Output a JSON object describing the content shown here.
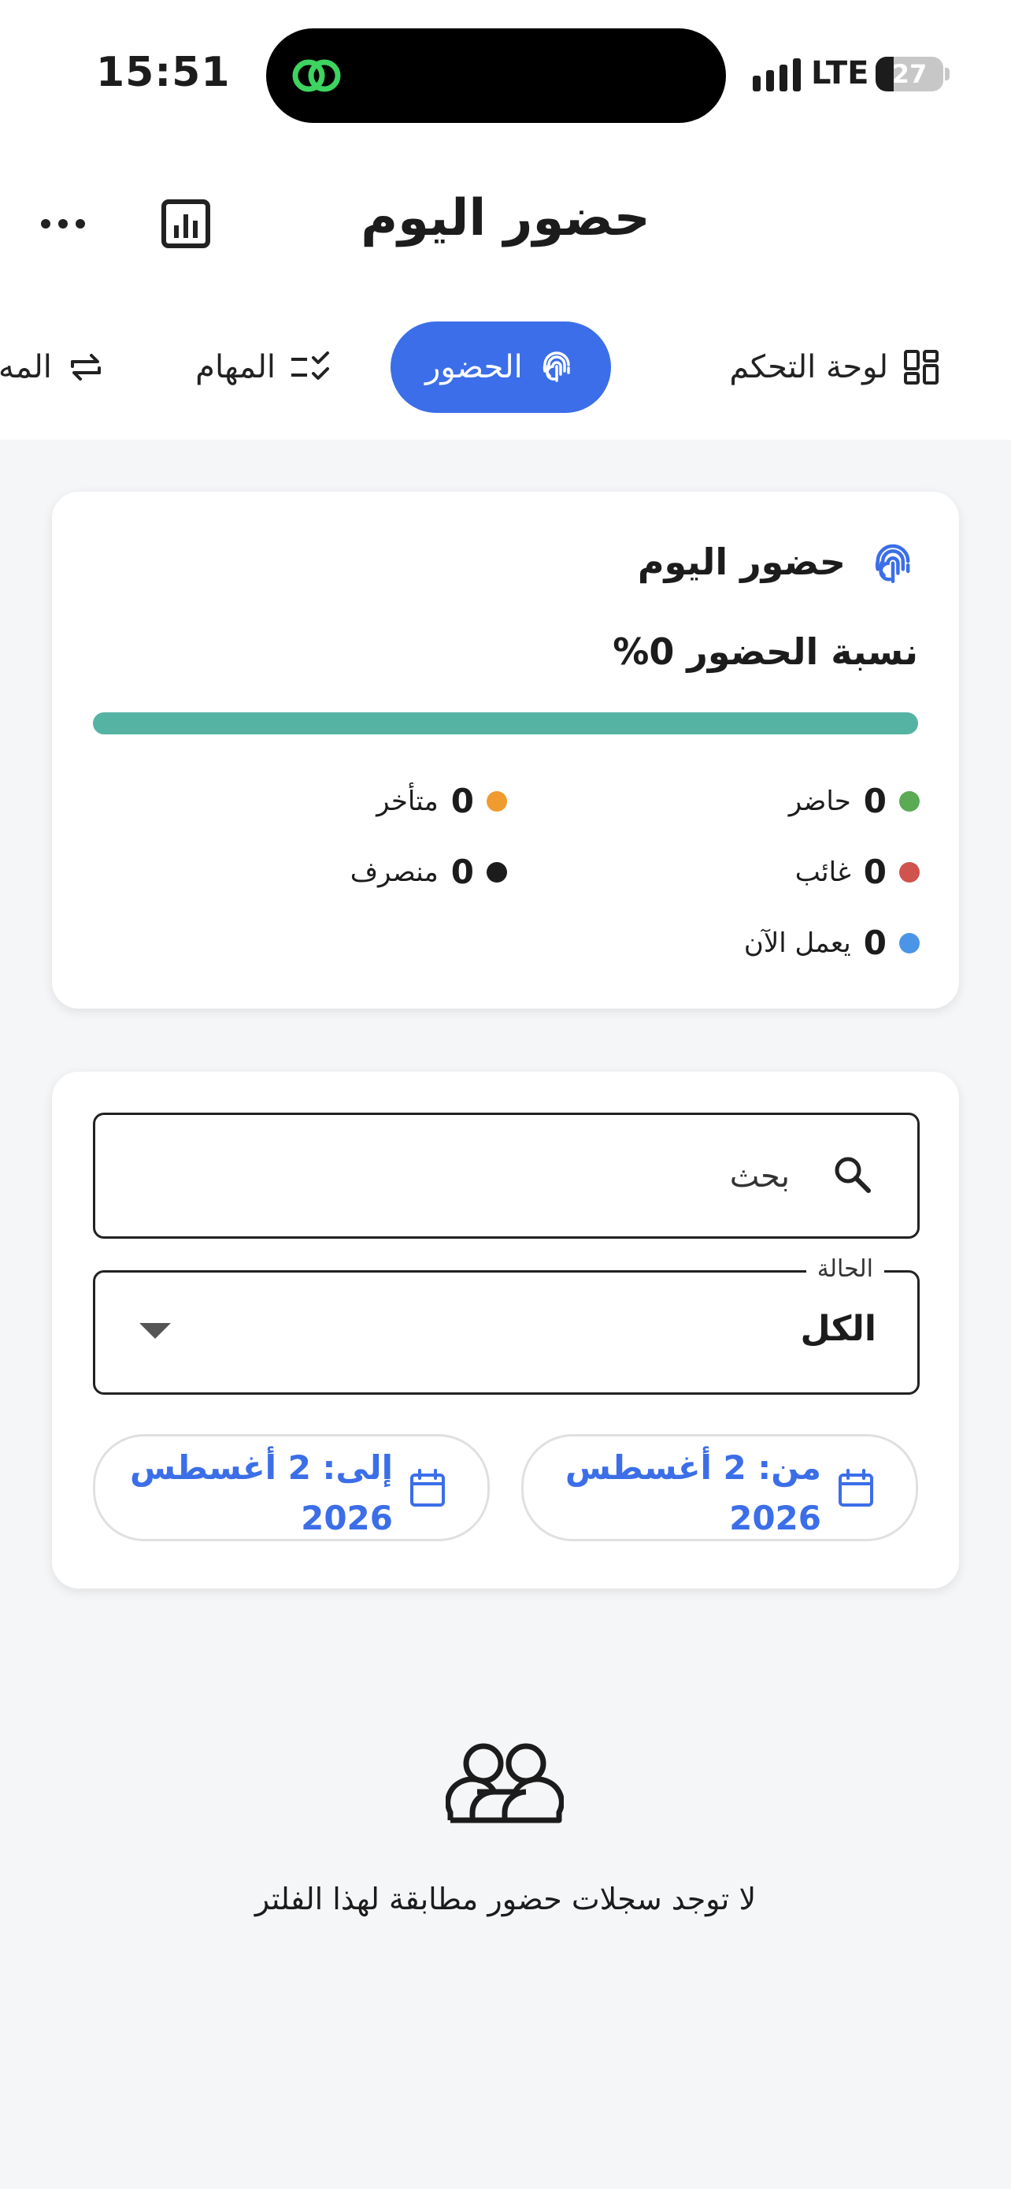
{
  "status_bar": {
    "time": "15:51",
    "network": "LTE",
    "battery": "27",
    "battery_level": 0.27
  },
  "app_bar": {
    "title": "حضور اليوم",
    "icons": [
      "more-horizontal-icon",
      "bar-chart-icon"
    ]
  },
  "tabs": [
    {
      "label": "لوحة التحكم",
      "icon": "dashboard-icon",
      "active": false
    },
    {
      "label": "الحضور",
      "icon": "fingerprint-icon",
      "active": true
    },
    {
      "label": "المهام",
      "icon": "checklist-icon",
      "active": false
    },
    {
      "label": "المه",
      "icon": "swap-icon",
      "active": false
    }
  ],
  "today_card": {
    "title": "حضور اليوم",
    "rate_text": "نسبة الحضور 0%",
    "rate_value": 0,
    "stats": [
      {
        "label": "حاضر",
        "value": "0",
        "color": "#5aab53"
      },
      {
        "label": "متأخر",
        "value": "0",
        "color": "#ef9b2f"
      },
      {
        "label": "غائب",
        "value": "0",
        "color": "#d0534e"
      },
      {
        "label": "منصرف",
        "value": "0",
        "color": "#1c1c1c"
      },
      {
        "label": "يعمل الآن",
        "value": "0",
        "color": "#4a95e8"
      }
    ]
  },
  "filters": {
    "search_placeholder": "بحث",
    "status_label": "الحالة",
    "status_value": "الكل",
    "from_date": "من: 2 أغسطس 2026",
    "to_date": "إلى: 2 أغسطس 2026"
  },
  "empty_state": {
    "icon": "people-icon",
    "text": "لا توجد سجلات حضور مطابقة لهذا الفلتر"
  },
  "colors": {
    "accent": "#3b6ee8",
    "progress": "#55b3a4"
  }
}
